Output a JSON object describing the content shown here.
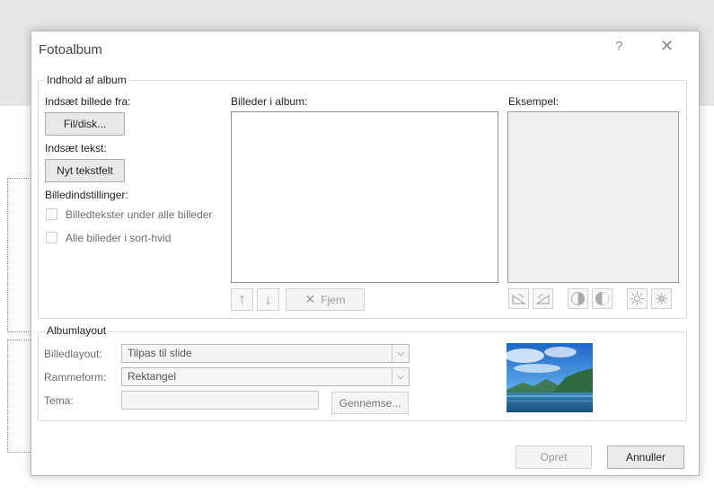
{
  "dialog": {
    "title": "Fotoalbum",
    "help_label": "?",
    "close_label": "✕"
  },
  "content_group": {
    "legend": "Indhold af album",
    "insert_picture_from": "Indsæt billede fra:",
    "file_disk_button": "Fil/disk...",
    "insert_text": "Indsæt tekst:",
    "new_textbox_button": "Nyt tekstfelt",
    "picture_options": "Billedindstillinger:",
    "captions_option": "Billedtekster under alle billeder",
    "black_white_option": "Alle billeder i sort-hvid",
    "pictures_in_album": "Billeder i album:",
    "preview_label": "Eksempel:",
    "move_up_icon": "↑",
    "move_down_icon": "↓",
    "remove_button": "Fjern",
    "remove_icon": "✕"
  },
  "preview_tools": [
    "rotate-left-icon",
    "rotate-right-icon",
    "contrast-up-icon",
    "contrast-down-icon",
    "brightness-up-icon",
    "brightness-down-icon"
  ],
  "layout_group": {
    "legend": "Albumlayout",
    "picture_layout_label": "Billedlayout:",
    "picture_layout_value": "Tilpas til slide",
    "frame_shape_label": "Rammeform:",
    "frame_shape_value": "Rektangel",
    "theme_label": "Tema:",
    "theme_value": "",
    "browse_button": "Gennemse..."
  },
  "footer": {
    "create_button": "Opret",
    "cancel_button": "Annuller"
  }
}
